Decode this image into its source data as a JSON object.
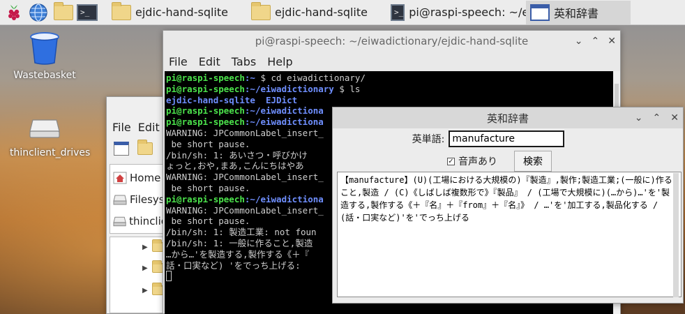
{
  "taskbar": {
    "tasks": [
      {
        "label": "ejdic-hand-sqlite",
        "icon": "folder-icon"
      },
      {
        "label": "ejdic-hand-sqlite",
        "icon": "folder-icon"
      },
      {
        "label": "pi@raspi-speech: ~/e...",
        "icon": "terminal-icon"
      },
      {
        "label": "英和辞書",
        "icon": "window-icon"
      }
    ],
    "terminal_icon_text": ">_"
  },
  "desktop": {
    "wastebasket": "Wastebasket",
    "thinclient": "thinclient_drives"
  },
  "filemanager": {
    "menu": [
      "File",
      "Edit"
    ],
    "places": [
      "Home",
      "Filesys",
      "thinclie"
    ]
  },
  "terminal": {
    "title": "pi@raspi-speech: ~/eiwadictionary/ejdic-hand-sqlite",
    "menu": [
      "File",
      "Edit",
      "Tabs",
      "Help"
    ],
    "lines": {
      "l1_prompt": "pi@raspi-speech",
      "l1_path": ":~ ",
      "l1_cmd": "$ cd eiwadictionary/",
      "l2_prompt": "pi@raspi-speech",
      "l2_path": ":~/eiwadictionary ",
      "l2_cmd": "$ ls",
      "l3": "ejdic-hand-sqlite  EJDict",
      "l4_prompt": "pi@raspi-speech",
      "l4_path": ":~/eiwadictiona",
      "l5_prompt": "pi@raspi-speech",
      "l5_path": ":~/eiwadictiona",
      "l6": "WARNING: JPCommonLabel_insert_",
      "l7": " be short pause.",
      "l8": "/bin/sh: 1: あいさつ・呼びかけ",
      "l9": "ょっと,おや,まあ,こんにちはやあ",
      "l10": "WARNING: JPCommonLabel_insert_",
      "l11": " be short pause.",
      "l12_prompt": "pi@raspi-speech",
      "l12_path": ":~/eiwadictiona",
      "l13": "WARNING: JPCommonLabel_insert_",
      "l14": " be short pause.",
      "l15": "/bin/sh: 1: 製造工業: not foun",
      "l16": "/bin/sh: 1: 一般に作ること,製造",
      "l17": "…から…'を製造する,製作する《＋『",
      "l18": "話・口実など) 'をでっち上げる:"
    }
  },
  "dict": {
    "title": "英和辞書",
    "label": "英単語:",
    "input_value": "manufacture",
    "checkbox_label": "音声あり",
    "checkbox_checked": true,
    "search_button": "検索",
    "result": "【manufacture】(U)(工場における大規模の)『製造』,製作;製造工業;(一般に)作ること,製造 / (C)《しばしば複数形で》『製品』 / (工場で大規模に)(…から)…'を'製造する,製作する《＋『名』＋『from』＋『名』》 / …'を'加工する,製品化する / (話・口実など)'を'でっち上げる"
  }
}
